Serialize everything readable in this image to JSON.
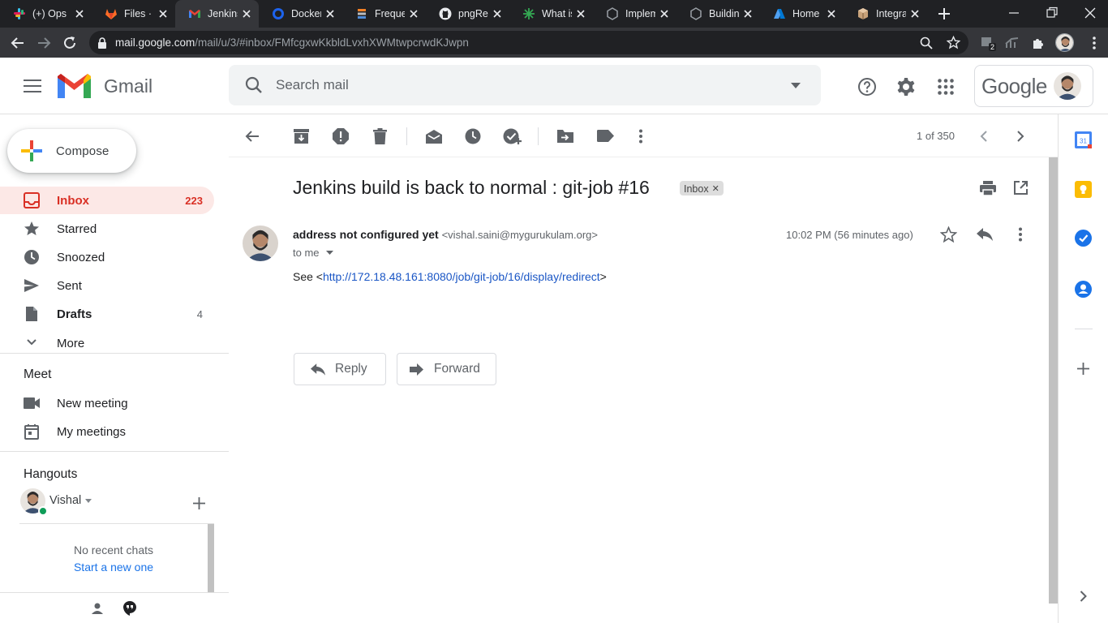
{
  "browser": {
    "tabs": [
      {
        "title": "(+) Ops",
        "icon": "slack-icon"
      },
      {
        "title": "Files · v",
        "icon": "gitlab-icon"
      },
      {
        "title": "Jenkins",
        "icon": "gmail-icon",
        "active": true
      },
      {
        "title": "Docker",
        "icon": "docker-icon"
      },
      {
        "title": "Freque",
        "icon": "stack-icon"
      },
      {
        "title": "pngRep",
        "icon": "github-icon"
      },
      {
        "title": "What is",
        "icon": "star-burst-icon"
      },
      {
        "title": "Implem",
        "icon": "hexagon-icon"
      },
      {
        "title": "Buildin",
        "icon": "hexagon-icon"
      },
      {
        "title": "Home",
        "icon": "azure-icon"
      },
      {
        "title": "Integra",
        "icon": "cube-icon"
      }
    ],
    "url_host": "mail.google.com",
    "url_path": "/mail/u/3/#inbox/FMfcgxwKkbldLvxhXWMtwpcrwdKJwpn",
    "extension_badge": "2"
  },
  "gmail": {
    "logo_text": "Gmail",
    "search_placeholder": "Search mail",
    "account_brand": "Google",
    "compose_label": "Compose",
    "nav": [
      {
        "label": "Inbox",
        "count": "223"
      },
      {
        "label": "Starred",
        "count": ""
      },
      {
        "label": "Snoozed",
        "count": ""
      },
      {
        "label": "Sent",
        "count": ""
      },
      {
        "label": "Drafts",
        "count": "4"
      },
      {
        "label": "More",
        "count": ""
      }
    ],
    "meet": {
      "title": "Meet",
      "items": [
        "New meeting",
        "My meetings"
      ]
    },
    "hangouts": {
      "title": "Hangouts",
      "user": "Vishal",
      "no_chats": "No recent chats",
      "start_new": "Start a new one"
    },
    "pager": "1 of 350",
    "message": {
      "subject": "Jenkins build is back to normal : git-job #16",
      "label": "Inbox",
      "sender_name": "address not configured yet",
      "sender_email": "<vishal.saini@mygurukulam.org>",
      "to": "to me",
      "time": "10:02 PM (56 minutes ago)",
      "body_prefix": "See <",
      "link": "http://172.18.48.161:8080/job/git-job/16/display/redirect",
      "body_suffix": ">"
    },
    "reply_label": "Reply",
    "forward_label": "Forward",
    "colors": {
      "accent_red": "#d93025",
      "active_bg": "#fce8e6",
      "link": "#1a56c5"
    }
  }
}
